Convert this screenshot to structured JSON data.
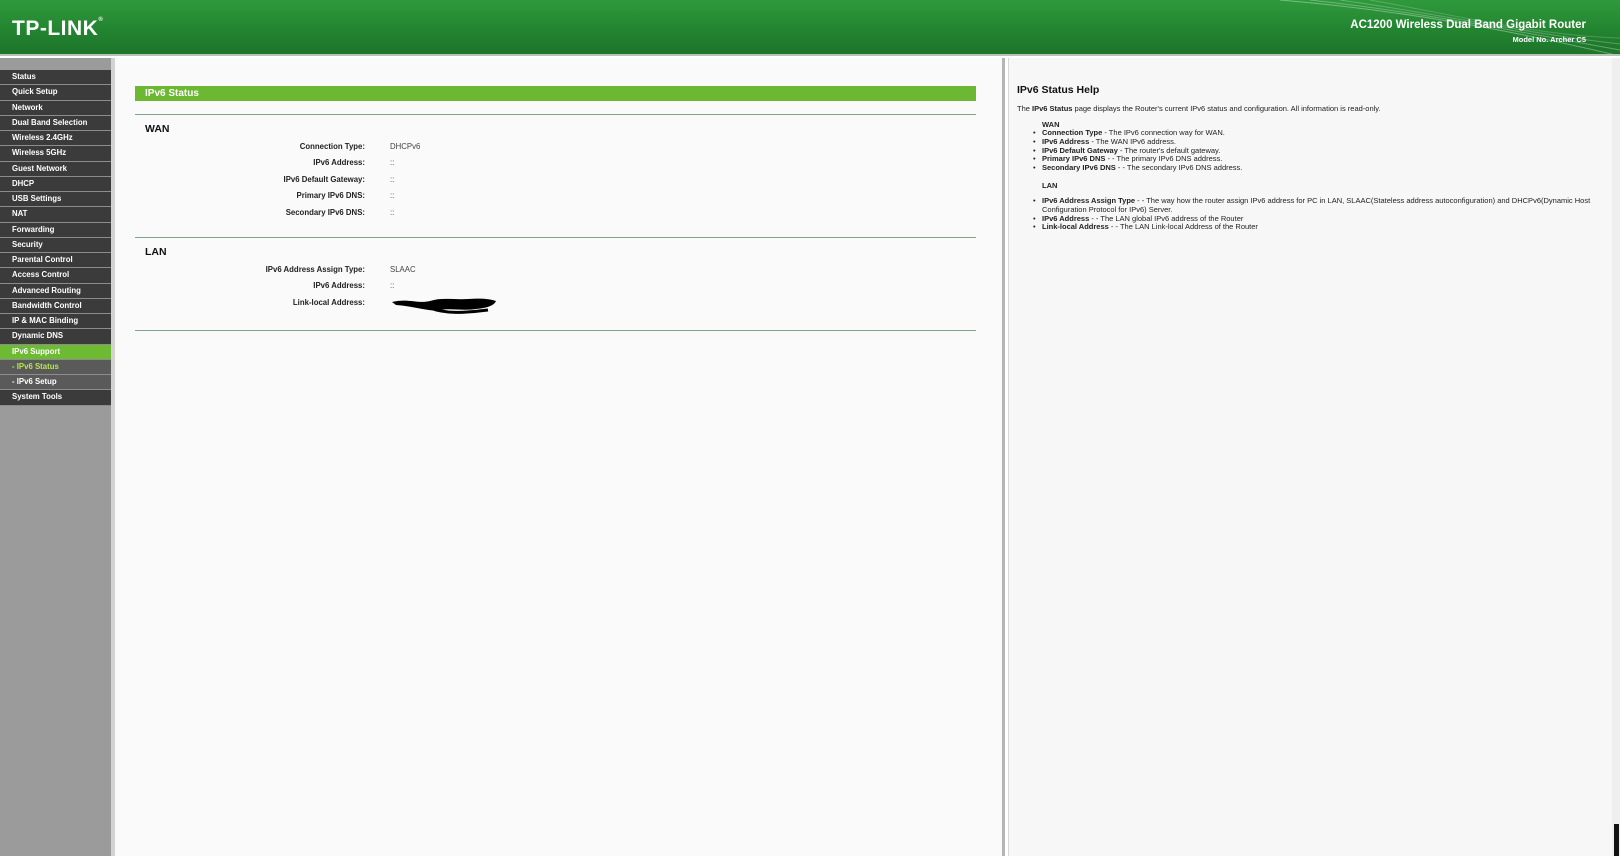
{
  "header": {
    "logo": "TP-LINK",
    "product": "AC1200 Wireless Dual Band Gigabit Router",
    "model": "Model No. Archer C5"
  },
  "nav": {
    "items": [
      {
        "label": "Status"
      },
      {
        "label": "Quick Setup"
      },
      {
        "label": "Network"
      },
      {
        "label": "Dual Band Selection"
      },
      {
        "label": "Wireless 2.4GHz"
      },
      {
        "label": "Wireless 5GHz"
      },
      {
        "label": "Guest Network"
      },
      {
        "label": "DHCP"
      },
      {
        "label": "USB Settings"
      },
      {
        "label": "NAT"
      },
      {
        "label": "Forwarding"
      },
      {
        "label": "Security"
      },
      {
        "label": "Parental Control"
      },
      {
        "label": "Access Control"
      },
      {
        "label": "Advanced Routing"
      },
      {
        "label": "Bandwidth Control"
      },
      {
        "label": "IP & MAC Binding"
      },
      {
        "label": "Dynamic DNS"
      },
      {
        "label": "IPv6 Support"
      },
      {
        "label": "- IPv6 Status"
      },
      {
        "label": "- IPv6 Setup"
      },
      {
        "label": "System Tools"
      }
    ]
  },
  "main": {
    "title": "IPv6 Status",
    "wan": {
      "heading": "WAN",
      "rows": [
        {
          "label": "Connection Type:",
          "value": "DHCPv6"
        },
        {
          "label": "IPv6 Address:",
          "value": "::"
        },
        {
          "label": "IPv6 Default Gateway:",
          "value": "::"
        },
        {
          "label": "Primary IPv6 DNS:",
          "value": "::"
        },
        {
          "label": "Secondary IPv6 DNS:",
          "value": "::"
        }
      ]
    },
    "lan": {
      "heading": "LAN",
      "rows": [
        {
          "label": "IPv6 Address Assign Type:",
          "value": "SLAAC"
        },
        {
          "label": "IPv6 Address:",
          "value": "::"
        },
        {
          "label": "Link-local Address:",
          "value": ""
        }
      ]
    }
  },
  "help": {
    "title": "IPv6 Status Help",
    "intro_pre": "The ",
    "intro_bold": "IPv6 Status",
    "intro_post": " page displays the Router's current IPv6 status and configuration. All information is read-only.",
    "wan_heading": "WAN",
    "wan_items": [
      {
        "term": "Connection Type",
        "desc": " - The IPv6 connection way for WAN."
      },
      {
        "term": "IPv6 Address",
        "desc": " - The WAN IPv6 address."
      },
      {
        "term": "IPv6 Default Gateway",
        "desc": " - The router's default gateway."
      },
      {
        "term": "Primary IPv6 DNS",
        "desc": " - - The primary IPv6 DNS address."
      },
      {
        "term": "Secondary IPv6 DNS",
        "desc": " - - The secondary IPv6 DNS address."
      }
    ],
    "lan_heading": "LAN",
    "lan_items": [
      {
        "term": "IPv6 Address Assign Type",
        "desc": " - - The way how the router assign IPv6 address for PC in LAN, SLAAC(Stateless address autoconfiguration) and DHCPv6(Dynamic Host Configuration Protocol for IPv6) Server."
      },
      {
        "term": "IPv6 Address",
        "desc": " - - The LAN global IPv6 address of the Router"
      },
      {
        "term": "Link-local Address",
        "desc": " - - The LAN Link-local Address of the Router"
      }
    ]
  },
  "colors": {
    "header_green": "#238430",
    "accent_green": "#6cb832",
    "nav_dark": "#3b3b3b",
    "nav_active": "#6dbb33",
    "sub_current_text": "#b6e84a"
  }
}
